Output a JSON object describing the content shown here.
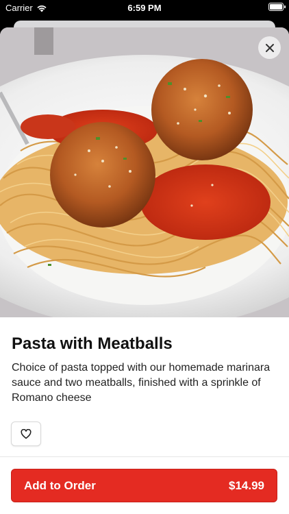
{
  "status_bar": {
    "carrier": "Carrier",
    "time": "6:59 PM",
    "icons": [
      "wifi-icon",
      "battery-icon"
    ]
  },
  "item": {
    "image_icon": "pasta-with-meatballs-photo",
    "name": "Pasta with Meatballs",
    "description": "Choice of pasta topped with our homemade marinara sauce and two meatballs, finished with a sprinkle of Romano cheese"
  },
  "actions": {
    "close_icon": "close-icon",
    "favorite_icon": "heart-outline-icon",
    "add_to_order_label": "Add to Order",
    "price": "$14.99"
  },
  "colors": {
    "accent": "#e42b22",
    "text": "#111111"
  }
}
